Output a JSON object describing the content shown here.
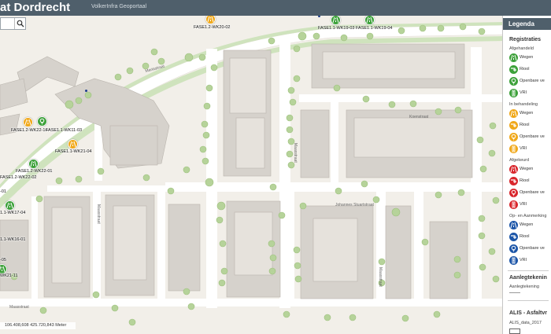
{
  "header": {
    "title": "at Dordrecht",
    "subtitle": "VolkerInfra Geoportaal"
  },
  "search": {
    "value": "",
    "placeholder": ""
  },
  "map": {
    "coordinates": "106.408,608 425.720,843 Meter",
    "streets": [
      "Mariastraat",
      "Johannes Stuartstraat",
      "Maasstraat",
      "Maasstraat",
      "Maasstraat",
      "Maasstraat",
      "Koenstraat"
    ],
    "markers": [
      {
        "label": "FASE1.2-WK20-02",
        "color": "orange",
        "icon": "road-icon"
      },
      {
        "label": "FASE1.1-WK19-03",
        "color": "green",
        "icon": "road-icon"
      },
      {
        "label": "FASE1.1-WK19-04",
        "color": "green",
        "icon": "road-icon"
      },
      {
        "label": "FASE1.2-WK22-14",
        "color": "orange",
        "icon": "road-icon"
      },
      {
        "label": "FASE1.1-WK11-03",
        "color": "green",
        "icon": "lightbulb-icon"
      },
      {
        "label": "FASE1.1-WK21-04",
        "color": "orange",
        "icon": "road-icon"
      },
      {
        "label": "FASE1.2-WK22-01",
        "color": "green",
        "icon": "road-icon"
      },
      {
        "label": "FASE1.2-WK22-02",
        "color": "green",
        "icon": "road-icon"
      },
      {
        "label": "-01",
        "color": "green",
        "icon": "road-icon"
      },
      {
        "label": "1.1-WK17-04",
        "color": "green",
        "icon": "road-icon"
      },
      {
        "label": "1.1-WK16-01",
        "color": "green",
        "icon": "road-icon"
      },
      {
        "label": "-05",
        "color": "green",
        "icon": "road-icon"
      },
      {
        "label": "WK21-11",
        "color": "green",
        "icon": "road-icon"
      }
    ]
  },
  "legend": {
    "title": "Legenda",
    "registraties": "Registraties",
    "groups": [
      {
        "name": "Afgehandeld",
        "items": [
          {
            "label": "Wegen",
            "color": "#3da13a",
            "icon": "road-icon"
          },
          {
            "label": "Riool",
            "color": "#3da13a",
            "icon": "sewer-icon"
          },
          {
            "label": "Openbare ve",
            "color": "#3da13a",
            "icon": "lightbulb-icon"
          },
          {
            "label": "VRI",
            "color": "#3da13a",
            "icon": "traffic-light-icon"
          }
        ]
      },
      {
        "name": "In behandeling",
        "items": [
          {
            "label": "Wegen",
            "color": "#f0a81a",
            "icon": "road-icon"
          },
          {
            "label": "Riool",
            "color": "#f0a81a",
            "icon": "sewer-icon"
          },
          {
            "label": "Openbare ve",
            "color": "#f0a81a",
            "icon": "lightbulb-icon"
          },
          {
            "label": "VRI",
            "color": "#f0a81a",
            "icon": "traffic-light-icon"
          }
        ]
      },
      {
        "name": "Afgekeurd",
        "items": [
          {
            "label": "Wegen",
            "color": "#d9262c",
            "icon": "road-icon"
          },
          {
            "label": "Riool",
            "color": "#d9262c",
            "icon": "sewer-icon"
          },
          {
            "label": "Openbare ve",
            "color": "#d9262c",
            "icon": "lightbulb-icon"
          },
          {
            "label": "VRI",
            "color": "#d9262c",
            "icon": "traffic-light-icon"
          }
        ]
      },
      {
        "name": "Op- en Aanmerking",
        "items": [
          {
            "label": "Wegen",
            "color": "#1d56a8",
            "icon": "road-icon"
          },
          {
            "label": "Riool",
            "color": "#1d56a8",
            "icon": "sewer-icon"
          },
          {
            "label": "Openbare ve",
            "color": "#1d56a8",
            "icon": "lightbulb-icon"
          },
          {
            "label": "VRI",
            "color": "#1d56a8",
            "icon": "traffic-light-icon"
          }
        ]
      }
    ],
    "aanleg_title": "Aanlegtekenin",
    "aanleg_sub": "Aanlegtekening",
    "alis_title": "ALIS - Asfaltvr",
    "alis_sub": "ALIS_data_2017"
  }
}
